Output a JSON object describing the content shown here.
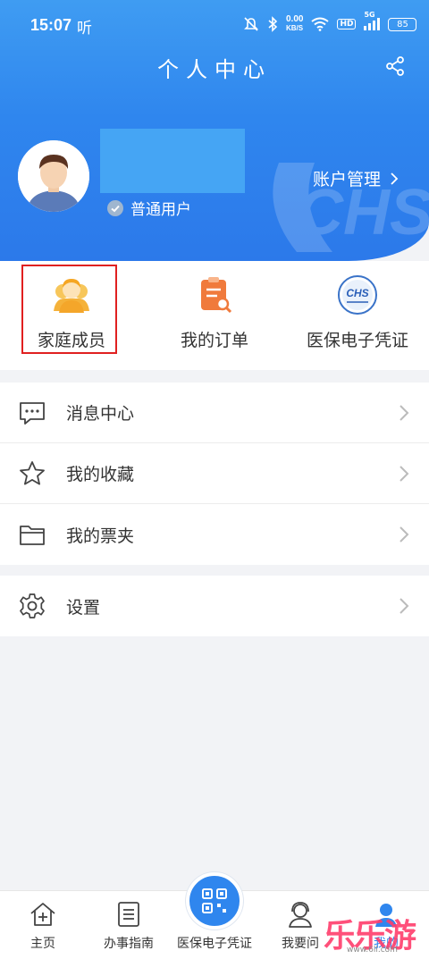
{
  "status_bar": {
    "time": "15:07",
    "app_indicator": "听",
    "net_speed_value": "0.00",
    "net_speed_unit": "KB/S",
    "hd_label": "HD",
    "signal_label": "5G",
    "battery": "85"
  },
  "header": {
    "title": "个人中心",
    "user_type": "普通用户",
    "account_management": "账户管理",
    "watermark": "CHS"
  },
  "quick_actions": [
    {
      "label": "家庭成员",
      "icon": "family-member-icon"
    },
    {
      "label": "我的订单",
      "icon": "order-icon"
    },
    {
      "label": "医保电子凭证",
      "icon": "chs-badge-icon",
      "badge_text": "CHS"
    }
  ],
  "menu": {
    "group1": [
      {
        "label": "消息中心",
        "icon": "message-icon"
      },
      {
        "label": "我的收藏",
        "icon": "star-icon"
      },
      {
        "label": "我的票夹",
        "icon": "folder-icon"
      }
    ],
    "group2": [
      {
        "label": "设置",
        "icon": "gear-icon"
      }
    ]
  },
  "bottom_nav": {
    "home": "主页",
    "guide": "办事指南",
    "center": "医保电子凭证",
    "ask": "我要问",
    "mine": "我的"
  },
  "watermark": {
    "text": "乐乐游戏",
    "url": "www.6ll.com"
  },
  "colors": {
    "primary": "#2f86ee",
    "highlight_border": "#e02020",
    "icon_orange": "#f07a3c",
    "icon_yellow": "#f5b23a"
  }
}
